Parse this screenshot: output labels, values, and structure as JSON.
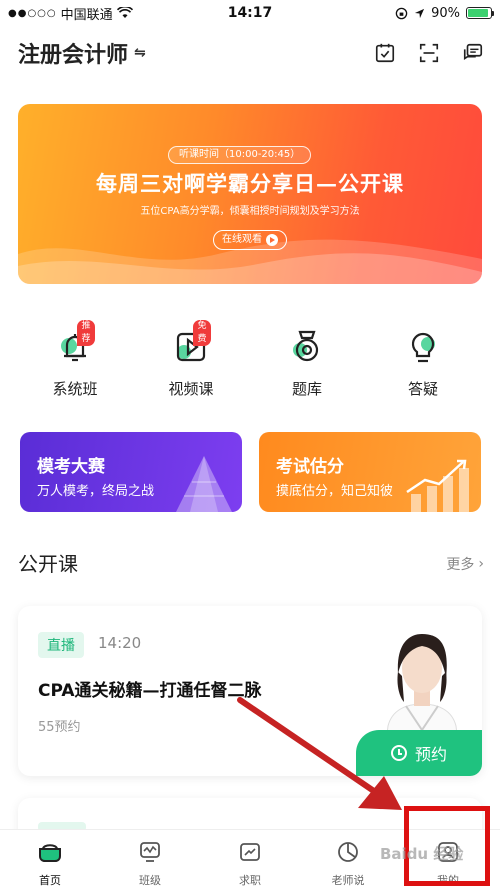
{
  "status_bar": {
    "carrier": "中国联通",
    "time": "14:17",
    "battery": "90%",
    "battery_level": 0.9
  },
  "header": {
    "title": "注册会计师"
  },
  "banner": {
    "tag": "听课时间（10:00-20:45）",
    "title": "每周三对啊学霸分享日—公开课",
    "subtitle": "五位CPA高分学霸，倾囊相授时间规划及学习方法",
    "button": "在线观看"
  },
  "quick_entries": [
    {
      "label": "系统班",
      "badge": "推荐",
      "icon": "bell-icon"
    },
    {
      "label": "视频课",
      "badge": "免费",
      "icon": "video-play-icon"
    },
    {
      "label": "题库",
      "badge": "",
      "icon": "question-bank-icon"
    },
    {
      "label": "答疑",
      "badge": "",
      "icon": "lightbulb-icon"
    }
  ],
  "cards": [
    {
      "title": "模考大赛",
      "subtitle": "万人模考，终局之战"
    },
    {
      "title": "考试估分",
      "subtitle": "摸底估分，知己知彼"
    }
  ],
  "section": {
    "title": "公开课",
    "more": "更多"
  },
  "live_card": {
    "badge": "直播",
    "time": "14:20",
    "title": "CPA通关秘籍—打通任督二脉",
    "count": "55预约",
    "button": "预约"
  },
  "bottom_nav": [
    {
      "label": "首页",
      "icon": "home-icon",
      "active": true
    },
    {
      "label": "班级",
      "icon": "class-icon",
      "active": false
    },
    {
      "label": "求职",
      "icon": "job-icon",
      "active": false
    },
    {
      "label": "老师说",
      "icon": "teacher-talk-icon",
      "active": false
    },
    {
      "label": "我的",
      "icon": "profile-icon",
      "active": false
    }
  ],
  "colors": {
    "brand_green": "#1fc27f",
    "badge_red": "#f03b3b",
    "annotation_red": "#d11"
  }
}
